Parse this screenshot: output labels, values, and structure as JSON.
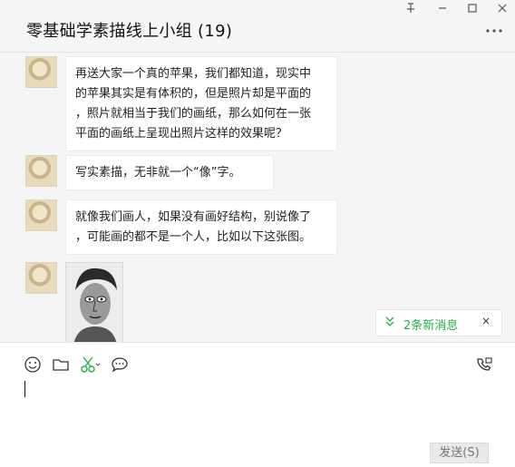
{
  "window": {
    "title": "零基础学素描线上小组 (19)",
    "pin_icon": "pin-icon",
    "minimize_icon": "minimize-icon",
    "maximize_icon": "maximize-icon",
    "close_icon": "close-icon",
    "more_icon": "more-icon"
  },
  "messages": [
    {
      "type": "text",
      "text": "再送大家一个真的苹果，我们都知道，现实中\n的苹果其实是有体积的，但是照片却是平面的\n，照片就相当于我们的画纸，那么如何在一张\n平面的画纸上呈现出照片这样的效果呢？"
    },
    {
      "type": "text",
      "text": "写实素描，无非就一个“像”字。"
    },
    {
      "type": "text",
      "text": "就像我们画人，如果没有画好结构，别说像了\n，可能画的都不是一个人，比如以下这张图。"
    },
    {
      "type": "image"
    }
  ],
  "new_messages": {
    "label": "2条新消息",
    "chevron_icon": "chevron-down-icon",
    "close_label": "×"
  },
  "toolbar": {
    "emoji_icon": "emoji-icon",
    "folder_icon": "folder-icon",
    "screenshot_icon": "scissors-icon",
    "chat_history_icon": "chat-bubble-icon",
    "call_icon": "phone-call-icon"
  },
  "input": {
    "value": ""
  },
  "send_button": {
    "label": "发送(S)"
  },
  "colors": {
    "accent_green": "#21b04a",
    "background": "#f5f5f5",
    "bubble": "#ffffff"
  }
}
